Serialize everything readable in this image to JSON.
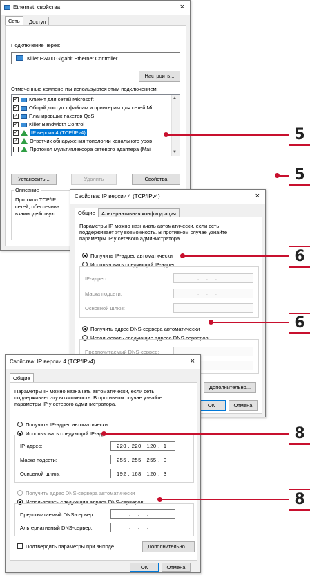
{
  "dialog1": {
    "title": "Ethernet: свойства",
    "close": "×",
    "tabs": [
      "Сеть",
      "Доступ"
    ],
    "connect_via_label": "Подключение через:",
    "adapter": "Killer E2400 Gigabit Ethernet Controller",
    "configure_button": "Настроить...",
    "components_label": "Отмеченные компоненты используются этим подключением:",
    "components": [
      {
        "label": "Клиент для сетей Microsoft",
        "checked": "✓"
      },
      {
        "label": "Общий доступ к файлам и принтерам для сетей Mi",
        "checked": "✓"
      },
      {
        "label": "Планировщик пакетов QoS",
        "checked": "✓"
      },
      {
        "label": "Killer Bandwidth Control",
        "checked": "✓"
      },
      {
        "label": "IP версии 4 (TCP/IPv4)",
        "checked": "✓"
      },
      {
        "label": "Ответчик обнаружения топологии канального уров",
        "checked": "✓"
      },
      {
        "label": "Протокол мультиплексора сетевого адаптера (Mai",
        "checked": ""
      }
    ],
    "install_button": "Установить...",
    "remove_button": "Удалить",
    "properties_button": "Свойства",
    "description_label": "Описание",
    "description_lines": [
      "Протокол TCP/IP",
      "сетей, обеспечива",
      "взаимодействую"
    ]
  },
  "dialog2": {
    "title": "Свойства: IP версии 4 (TCP/IPv4)",
    "close": "×",
    "tabs": [
      "Общие",
      "Альтернативная конфигурация"
    ],
    "intro": [
      "Параметры IP можно назначать автоматически, если сеть",
      "поддерживает эту возможность. В противном случае узнайте",
      "параметры IP у сетевого администратора."
    ],
    "auto_ip": "Получить IP-адрес автоматически",
    "manual_ip": "Использовать следующий IP-адрес:",
    "ip_label": "IP-адрес:",
    "mask_label": "Маска подсети:",
    "gateway_label": "Основной шлюз:",
    "empty_ip": ".    .    .",
    "auto_dns": "Получить адрес DNS-сервера автоматически",
    "manual_dns": "Использовать следующие адреса DNS-серверов:",
    "preferred_dns_label": "Предпочитаемый DNS-сервер:",
    "advanced_button": "Дополнительно...",
    "ok_button": "ОК",
    "cancel_button": "Отмена"
  },
  "dialog3": {
    "title": "Свойства: IP версии 4 (TCP/IPv4)",
    "close": "×",
    "tabs": [
      "Общие"
    ],
    "intro": [
      "Параметры IP можно назначать автоматически, если сеть",
      "поддерживает эту возможность. В противном случае узнайте",
      "параметры IP у сетевого администратора."
    ],
    "auto_ip": "Получить IP-адрес автоматически",
    "manual_ip": "Использовать следующий IP-адрес:",
    "ip_label": "IP-адрес:",
    "ip_value": "220 . 220 . 120 .  1",
    "mask_label": "Маска подсети:",
    "mask_value": "255 . 255 . 255 .  0",
    "gateway_label": "Основной шлюз:",
    "gateway_value": "192 . 168 . 120 .  3",
    "auto_dns": "Получить адрес DNS-сервера автоматически",
    "manual_dns": "Использовать следующие адреса DNS-серверов:",
    "preferred_dns_label": "Предпочитаемый DNS-сервер:",
    "alternate_dns_label": "Альтернативный DNS-сервер:",
    "empty_ip": ".    .    .",
    "validate_label": "Подтвердить параметры при выходе",
    "advanced_button": "Дополнительно...",
    "ok_button": "ОК",
    "cancel_button": "Отмена"
  },
  "steps": [
    "5",
    "5",
    "6",
    "6",
    "8",
    "8"
  ],
  "colors": {
    "callout": "#c8102e",
    "selection": "#0078d7"
  }
}
